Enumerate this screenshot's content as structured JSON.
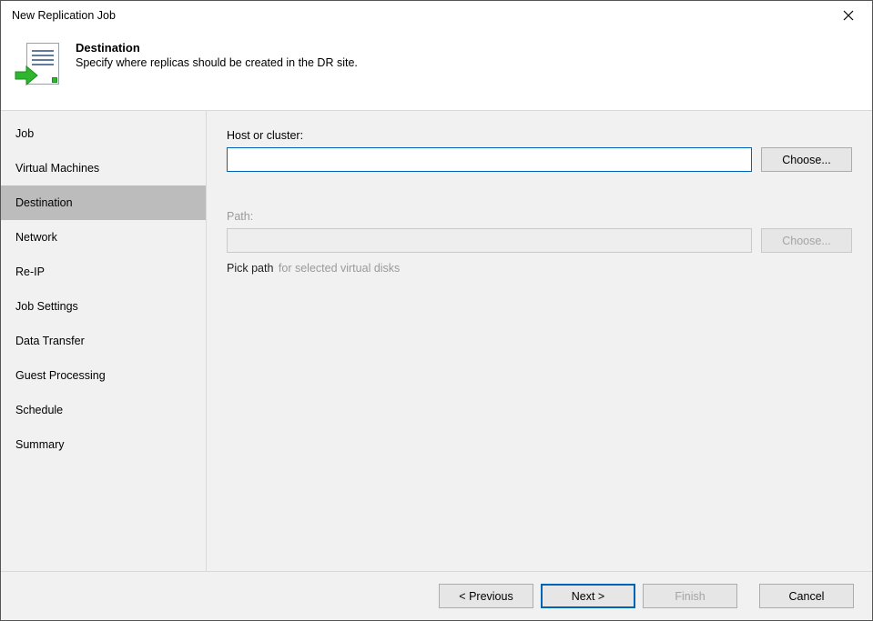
{
  "window": {
    "title": "New Replication Job"
  },
  "header": {
    "title": "Destination",
    "subtitle": "Specify where replicas should be created in the DR site."
  },
  "sidebar": {
    "items": [
      {
        "label": "Job",
        "selected": false
      },
      {
        "label": "Virtual Machines",
        "selected": false
      },
      {
        "label": "Destination",
        "selected": true
      },
      {
        "label": "Network",
        "selected": false
      },
      {
        "label": "Re-IP",
        "selected": false
      },
      {
        "label": "Job Settings",
        "selected": false
      },
      {
        "label": "Data Transfer",
        "selected": false
      },
      {
        "label": "Guest Processing",
        "selected": false
      },
      {
        "label": "Schedule",
        "selected": false
      },
      {
        "label": "Summary",
        "selected": false
      }
    ]
  },
  "content": {
    "host_label": "Host or cluster:",
    "host_value": "",
    "host_choose": "Choose...",
    "path_label": "Path:",
    "path_value": "",
    "path_choose": "Choose...",
    "pick_path_link": "Pick path",
    "pick_path_suffix": "for selected virtual disks"
  },
  "footer": {
    "previous": "< Previous",
    "next": "Next >",
    "finish": "Finish",
    "cancel": "Cancel"
  }
}
